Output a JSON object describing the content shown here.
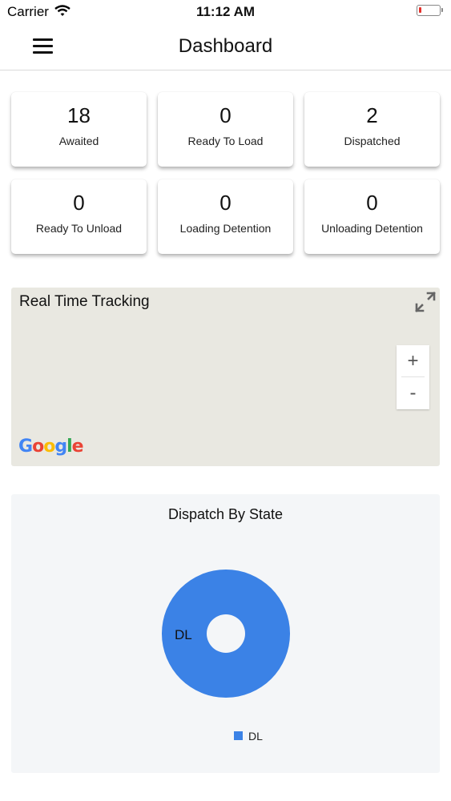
{
  "status_bar": {
    "carrier": "Carrier",
    "time": "11:12 AM"
  },
  "header": {
    "title": "Dashboard"
  },
  "stats": [
    {
      "value": "18",
      "label": "Awaited"
    },
    {
      "value": "0",
      "label": "Ready To Load"
    },
    {
      "value": "2",
      "label": "Dispatched"
    },
    {
      "value": "0",
      "label": "Ready To Unload"
    },
    {
      "value": "0",
      "label": "Loading Detention"
    },
    {
      "value": "0",
      "label": "Unloading Detention"
    }
  ],
  "map": {
    "title": "Real Time Tracking",
    "zoom_in": "+",
    "zoom_out": "-",
    "provider": "Google"
  },
  "chart_data": {
    "type": "pie",
    "title": "Dispatch By State",
    "categories": [
      "DL"
    ],
    "values": [
      100
    ],
    "colors": [
      "#3b82e6"
    ],
    "donut": true,
    "legend": "bottom"
  }
}
